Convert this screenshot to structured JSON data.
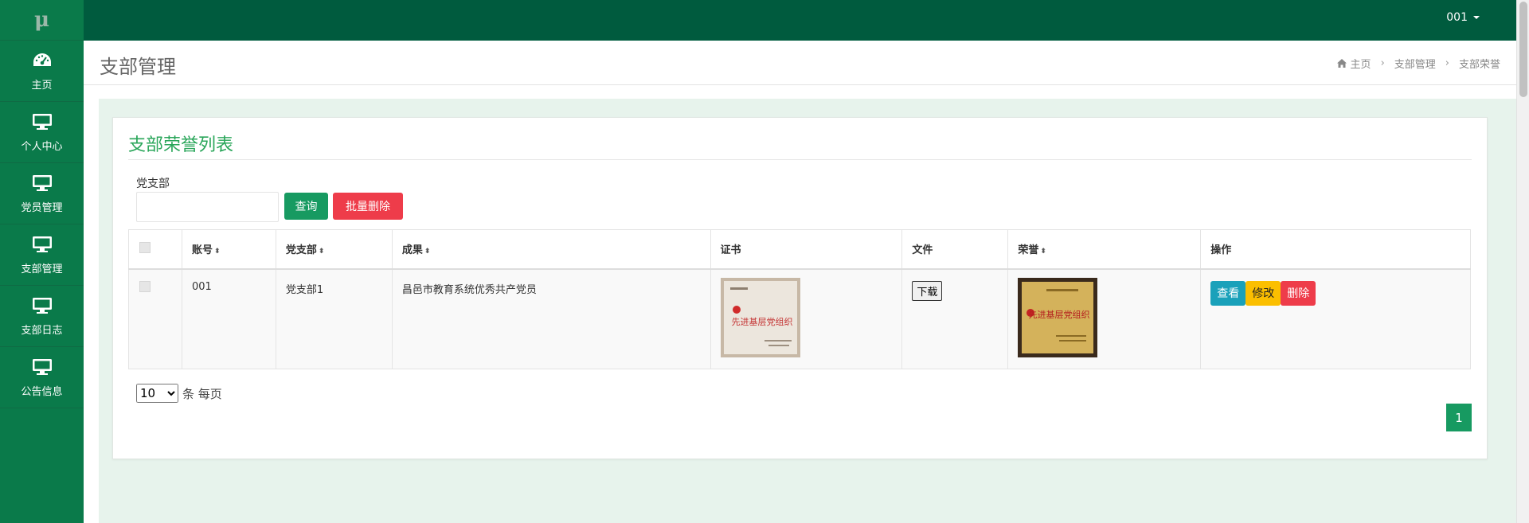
{
  "logo_text": "μ",
  "nav": [
    {
      "label": "主页",
      "icon": "dashboard-icon"
    },
    {
      "label": "个人中心",
      "icon": "monitor-icon"
    },
    {
      "label": "党员管理",
      "icon": "monitor-icon"
    },
    {
      "label": "支部管理",
      "icon": "monitor-icon"
    },
    {
      "label": "支部日志",
      "icon": "monitor-icon"
    },
    {
      "label": "公告信息",
      "icon": "monitor-icon"
    }
  ],
  "topbar": {
    "user": "001"
  },
  "header": {
    "title": "支部管理",
    "breadcrumb": [
      "主页",
      "支部管理",
      "支部荣誉"
    ]
  },
  "panel": {
    "title": "支部荣誉列表",
    "filter_label": "党支部",
    "filter_value": "",
    "search_label": "查询",
    "batch_delete_label": "批量删除"
  },
  "table": {
    "headers": [
      "账号",
      "党支部",
      "成果",
      "证书",
      "文件",
      "荣誉",
      "操作"
    ],
    "rows": [
      {
        "account": "001",
        "branch": "党支部1",
        "achievement": "昌邑市教育系统优秀共产党员",
        "certificate_text": "先进基层党组织",
        "file_button": "下载",
        "honor_text": "先进基层党组织",
        "actions": {
          "view": "查看",
          "edit": "修改",
          "delete": "删除"
        }
      }
    ]
  },
  "pagination": {
    "page_size": "10",
    "page_size_options": [
      "10"
    ],
    "page_size_suffix": "条 每页",
    "current_page": "1"
  },
  "colors": {
    "sidebar": "#0a7a4a",
    "topbar": "#005b3e",
    "accent_green": "#179a61",
    "danger": "#ee3c4a",
    "info": "#1aa1ba",
    "warning": "#fbbf00"
  }
}
